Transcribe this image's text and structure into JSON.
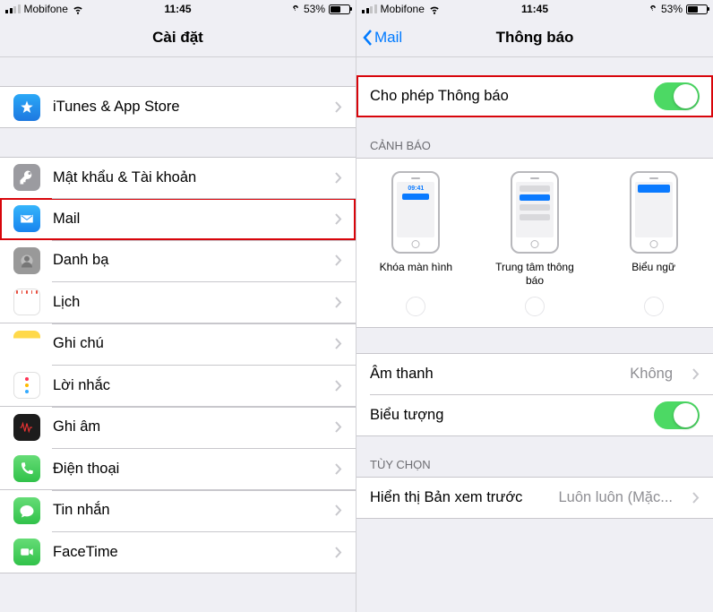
{
  "status": {
    "carrier": "Mobifone",
    "time": "11:45",
    "battery_pct": "53%"
  },
  "left": {
    "title": "Cài đặt",
    "items": {
      "itunes": "iTunes & App Store",
      "passwords": "Mật khẩu & Tài khoản",
      "mail": "Mail",
      "contacts": "Danh bạ",
      "calendar": "Lịch",
      "notes": "Ghi chú",
      "reminders": "Lời nhắc",
      "voice": "Ghi âm",
      "phone": "Điện thoại",
      "messages": "Tin nhắn",
      "facetime": "FaceTime"
    }
  },
  "right": {
    "back": "Mail",
    "title": "Thông báo",
    "allow": "Cho phép Thông báo",
    "alerts_header": "CẢNH BÁO",
    "alerts": {
      "lockscreen": "Khóa màn hình",
      "notif_center": "Trung tâm thông báo",
      "banners": "Biểu ngữ",
      "mock_time": "09:41"
    },
    "sounds_label": "Âm thanh",
    "sounds_value": "Không",
    "badges_label": "Biểu tượng",
    "options_header": "TÙY CHỌN",
    "preview_label": "Hiển thị Bản xem trước",
    "preview_value": "Luôn luôn (Mặc..."
  }
}
